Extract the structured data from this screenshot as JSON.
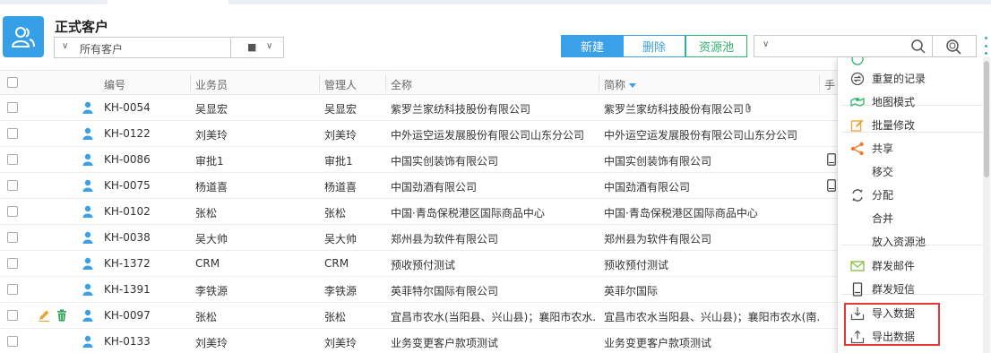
{
  "header": {
    "title": "正式客户",
    "filter_value": "所有客户",
    "buttons": {
      "new": "新建",
      "delete": "删除",
      "pool": "资源池"
    },
    "search_value": ""
  },
  "table": {
    "columns": [
      "编号",
      "业务员",
      "管理人",
      "全称",
      "简称",
      "手"
    ],
    "rows": [
      {
        "code": "KH-0054",
        "salesperson": "吴显宏",
        "manager": "吴显宏",
        "full_name": "紫罗兰家纺科技股份有限公司",
        "short_name": "紫罗兰家纺科技股份有限公司",
        "attach": true,
        "phone": false,
        "edit": false
      },
      {
        "code": "KH-0122",
        "salesperson": "刘美玲",
        "manager": "刘美玲",
        "full_name": "中外运空运发展股份有限公司山东分公司",
        "short_name": "中外运空运发展股份有限公司山东分公司",
        "attach": false,
        "phone": false,
        "edit": false
      },
      {
        "code": "KH-0086",
        "salesperson": "审批1",
        "manager": "审批1",
        "full_name": "中国实创装饰有限公司",
        "short_name": "中国实创装饰有限公司",
        "attach": false,
        "phone": true,
        "edit": false
      },
      {
        "code": "KH-0075",
        "salesperson": "杨道喜",
        "manager": "杨道喜",
        "full_name": "中国劲酒有限公司",
        "short_name": "中国劲酒有限公司",
        "attach": false,
        "phone": true,
        "edit": false
      },
      {
        "code": "KH-0102",
        "salesperson": "张松",
        "manager": "张松",
        "full_name": "中国·青岛保税港区国际商品中心",
        "short_name": "中国·青岛保税港区国际商品中心",
        "attach": false,
        "phone": false,
        "edit": false
      },
      {
        "code": "KH-0038",
        "salesperson": "吴大帅",
        "manager": "吴大帅",
        "full_name": "郑州县为软件有限公司",
        "short_name": "郑州县为软件有限公司",
        "attach": false,
        "phone": false,
        "edit": false
      },
      {
        "code": "KH-1372",
        "salesperson": "CRM",
        "manager": "CRM",
        "full_name": "预收预付测试",
        "short_name": "预收预付测试",
        "attach": false,
        "phone": false,
        "edit": false
      },
      {
        "code": "KH-1391",
        "salesperson": "李铁源",
        "manager": "李铁源",
        "full_name": "英菲特尔国际有限公司",
        "short_name": "英菲尔国际",
        "attach": false,
        "phone": false,
        "edit": false
      },
      {
        "code": "KH-0097",
        "salesperson": "张松",
        "manager": "张松",
        "full_name": "宜昌市农水(当阳县、兴山县)；襄阳市农水...",
        "short_name": "宜昌市农水当阳县、兴山县)；襄阳市农水(南...",
        "attach": false,
        "phone": false,
        "edit": true
      },
      {
        "code": "KH-0133",
        "salesperson": "刘美玲",
        "manager": "刘美玲",
        "full_name": "业务变更客户款项测试",
        "short_name": "业务变更客户款项测试",
        "attach": false,
        "phone": false,
        "edit": false
      }
    ]
  },
  "menu": {
    "items": [
      {
        "label": "重复的记录",
        "icon": "duplicate-icon"
      },
      {
        "label": "地图模式",
        "icon": "map-icon"
      },
      {
        "label": "批量修改",
        "icon": "batch-edit-icon"
      },
      {
        "label": "共享",
        "icon": "share-icon"
      },
      {
        "label": "移交",
        "icon": ""
      },
      {
        "label": "分配",
        "icon": "assign-icon"
      },
      {
        "label": "合并",
        "icon": ""
      },
      {
        "label": "放入资源池",
        "icon": ""
      },
      {
        "label": "群发邮件",
        "icon": "mail-icon"
      },
      {
        "label": "群发短信",
        "icon": "sms-icon"
      },
      {
        "label": "导入数据",
        "icon": "import-icon"
      },
      {
        "label": "导出数据",
        "icon": "export-icon"
      }
    ]
  },
  "colors": {
    "accent": "#3aa0e8",
    "green": "#2fb66d",
    "orange": "#f0a030",
    "highlight": "#e53935"
  }
}
